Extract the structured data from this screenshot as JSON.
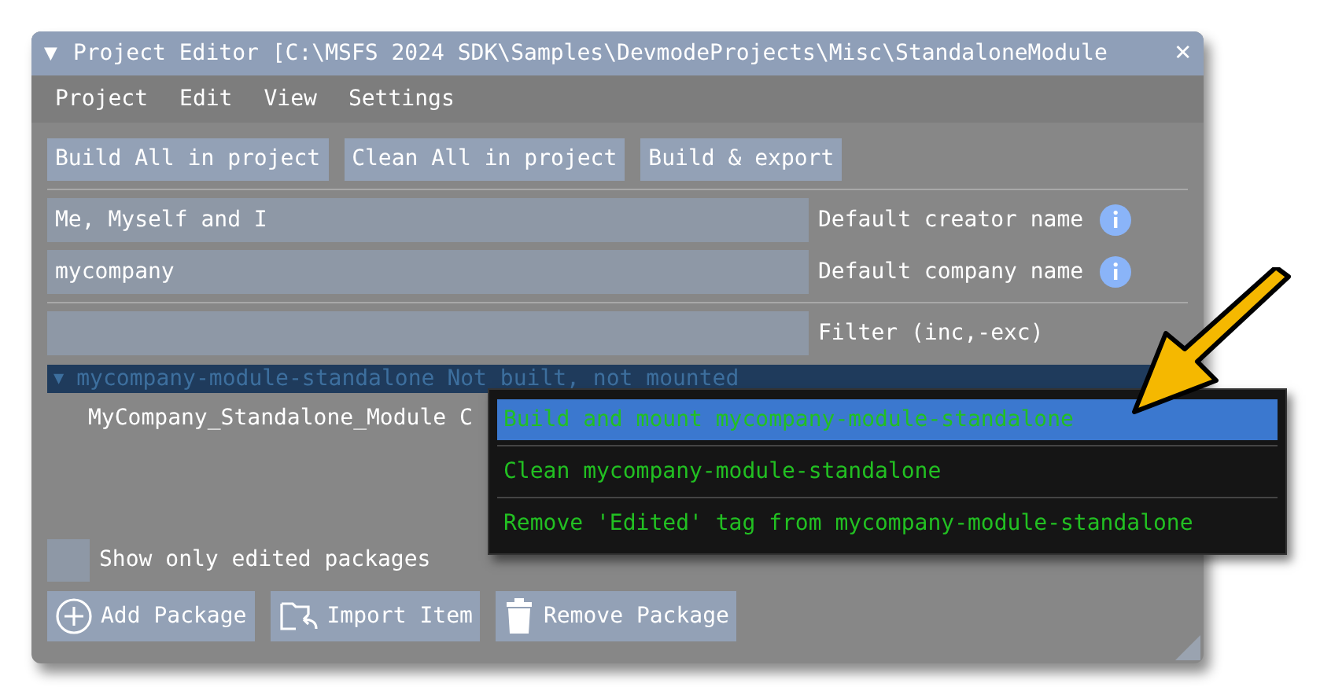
{
  "window": {
    "title": "Project Editor [C:\\MSFS 2024 SDK\\Samples\\DevmodeProjects\\Misc\\StandaloneModule",
    "collapse_glyph": "▼",
    "close_glyph": "✕"
  },
  "menu": [
    "Project",
    "Edit",
    "View",
    "Settings"
  ],
  "toolbar": [
    "Build All in project",
    "Clean All in project",
    "Build & export"
  ],
  "fields": [
    {
      "value": "Me, Myself and I",
      "label": "Default creator name",
      "info": true
    },
    {
      "value": "mycompany",
      "label": "Default company name",
      "info": true
    }
  ],
  "filter": {
    "label": "Filter (inc,-exc)"
  },
  "tree": [
    {
      "glyph": "▼",
      "name": "mycompany-module-standalone",
      "status": "Not built, not mounted",
      "selected": true,
      "expanded": true,
      "children": [
        {
          "name": "MyCompany_Standalone_Module C",
          "selected": false
        }
      ]
    }
  ],
  "context_menu": [
    {
      "label": "Build and mount mycompany-module-standalone",
      "selected": true
    },
    {
      "label": "Clean mycompany-module-standalone",
      "selected": false
    },
    {
      "label": "Remove 'Edited' tag from mycompany-module-standalone",
      "selected": false
    }
  ],
  "show_only_edited": {
    "label": "Show only edited packages",
    "checked": false
  },
  "bottom_buttons": [
    {
      "kind": "add",
      "label": "Add Package"
    },
    {
      "kind": "import",
      "label": "Import Item"
    },
    {
      "kind": "remove",
      "label": "Remove Package"
    }
  ]
}
